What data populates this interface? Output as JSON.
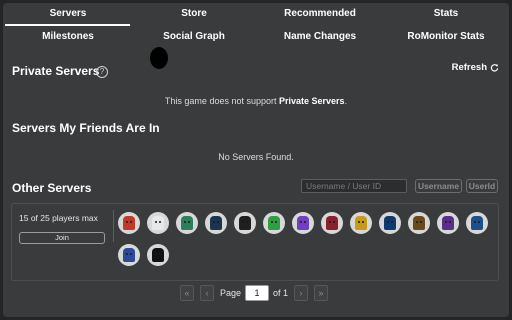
{
  "tabs_row1": [
    "Servers",
    "Store",
    "Recommended",
    "Stats"
  ],
  "tabs_row2": [
    "Milestones",
    "Social Graph",
    "Name Changes",
    "RoMonitor Stats"
  ],
  "private_servers": {
    "title": "Private Servers",
    "help_icon": "question-circle-icon",
    "refresh_label": "Refresh",
    "refresh_icon": "refresh-icon",
    "notice_prefix": "This game does not support ",
    "notice_link": "Private Servers",
    "notice_suffix": "."
  },
  "friends_servers": {
    "title": "Servers My Friends Are In",
    "empty_text": "No Servers Found."
  },
  "other_servers": {
    "title": "Other Servers",
    "search_placeholder": "Username / User ID",
    "username_button": "Username",
    "userid_button": "UserId"
  },
  "server_card": {
    "players_text": "15 of 25 players max",
    "join_label": "Join",
    "players_shown": 15
  },
  "avatars": [
    {
      "color": "#c0392b"
    },
    {
      "color": "#e8e8e8"
    },
    {
      "color": "#2e7d5b"
    },
    {
      "color": "#1b3550"
    },
    {
      "color": "#1f1f1f"
    },
    {
      "color": "#2f9e44"
    },
    {
      "color": "#6f3fbf"
    },
    {
      "color": "#8a1f2d"
    },
    {
      "color": "#c79a1a"
    },
    {
      "color": "#0e3a6e"
    },
    {
      "color": "#6b4a1e"
    },
    {
      "color": "#5a2f8a"
    },
    {
      "color": "#1e4f8a"
    },
    {
      "color": "#2c4a9a"
    },
    {
      "color": "#111111"
    }
  ],
  "pagination": {
    "first_icon": "double-chevron-left-icon",
    "prev_icon": "chevron-left-icon",
    "next_icon": "chevron-right-icon",
    "last_icon": "double-chevron-right-icon",
    "page_label": "Page",
    "current_page": "1",
    "of_text": "of 1"
  },
  "colors": {
    "background": "#232527",
    "panel": "#393b3d",
    "active_underline": "#ffffff"
  }
}
